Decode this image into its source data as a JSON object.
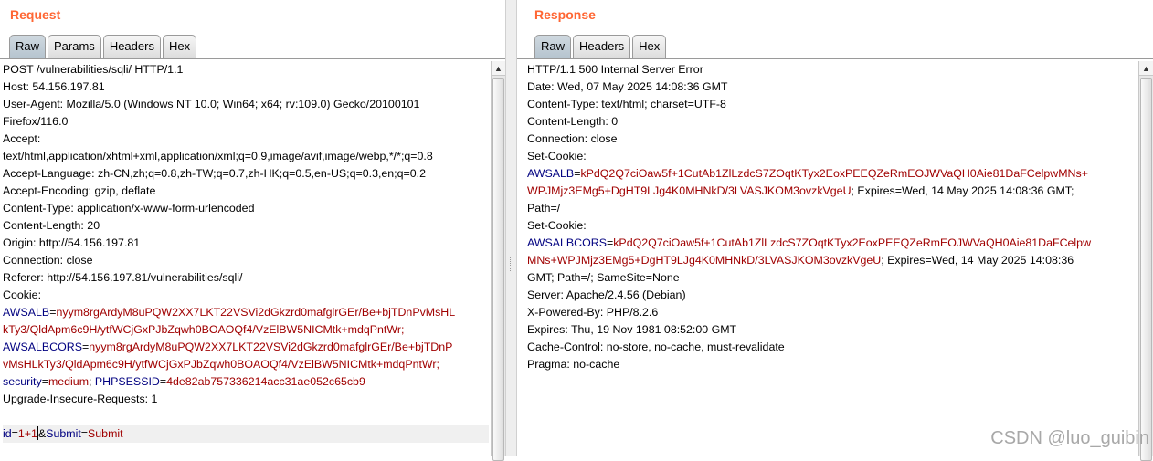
{
  "request": {
    "title": "Request",
    "tabs": [
      "Raw",
      "Params",
      "Headers",
      "Hex"
    ],
    "active_tab": "Raw",
    "lines": [
      "POST /vulnerabilities/sqli/ HTTP/1.1",
      "Host: 54.156.197.81",
      "User-Agent: Mozilla/5.0 (Windows NT 10.0; Win64; x64; rv:109.0) Gecko/20100101",
      "Firefox/116.0",
      "Accept:",
      "text/html,application/xhtml+xml,application/xml;q=0.9,image/avif,image/webp,*/*;q=0.8",
      "Accept-Language: zh-CN,zh;q=0.8,zh-TW;q=0.7,zh-HK;q=0.5,en-US;q=0.3,en;q=0.2",
      "Accept-Encoding: gzip, deflate",
      "Content-Type: application/x-www-form-urlencoded",
      "Content-Length: 20",
      "Origin: http://54.156.197.81",
      "Connection: close",
      "Referer: http://54.156.197.81/vulnerabilities/sqli/",
      "Cookie:"
    ],
    "cookie_lines": [
      {
        "k": "AWSALB",
        "eq": "=",
        "v": "nyym8rgArdyM8uPQW2XX7LKT22VSVi2dGkzrd0mafglrGEr/Be+bjTDnPvMsHL"
      },
      {
        "k": "",
        "eq": "",
        "v": "kTy3/QldApm6c9H/ytfWCjGxPJbZqwh0BOAOQf4/VzElBW5NICMtk+mdqPntWr;"
      },
      {
        "k": "AWSALBCORS",
        "eq": "=",
        "v": "nyym8rgArdyM8uPQW2XX7LKT22VSVi2dGkzrd0mafglrGEr/Be+bjTDnP"
      },
      {
        "k": "",
        "eq": "",
        "v": "vMsHLkTy3/QldApm6c9H/ytfWCjGxPJbZqwh0BOAOQf4/VzElBW5NICMtk+mdqPntWr;"
      }
    ],
    "security_line": {
      "k1": "security",
      "v1": "medium",
      "sep": "; ",
      "k2": "PHPSESSID",
      "v2": "4de82ab757336214acc31ae052c65cb9"
    },
    "upgrade_line": "Upgrade-Insecure-Requests: 1",
    "body_line": {
      "k1": "id",
      "v1a": "1+1",
      "v1b": "",
      "amp": "&",
      "k2": "Submit",
      "v2": "Submit"
    }
  },
  "response": {
    "title": "Response",
    "tabs": [
      "Raw",
      "Headers",
      "Hex"
    ],
    "active_tab": "Raw",
    "lines_top": [
      "HTTP/1.1 500 Internal Server Error",
      "Date: Wed, 07 May 2025 14:08:36 GMT",
      "Content-Type: text/html; charset=UTF-8",
      "Content-Length: 0",
      "Connection: close",
      "Set-Cookie:"
    ],
    "cookie1": {
      "k": "AWSALB",
      "v1": "kPdQ2Q7ciOaw5f+1CutAb1ZlLzdcS7ZOqtKTyx2EoxPEEQZeRmEOJWVaQH0Aie81DaFCelpwMNs+",
      "v2": "WPJMjz3EMg5+DgHT9LJg4K0MHNkD/3LVASJKOM3ovzkVgeU",
      "rest": "; Expires=Wed, 14 May 2025 14:08:36 GMT;",
      "rest2": "Path=/"
    },
    "setcookie2_label": "Set-Cookie:",
    "cookie2": {
      "k": "AWSALBCORS",
      "v1": "kPdQ2Q7ciOaw5f+1CutAb1ZlLzdcS7ZOqtKTyx2EoxPEEQZeRmEOJWVaQH0Aie81DaFCelpw",
      "v2": "MNs+WPJMjz3EMg5+DgHT9LJg4K0MHNkD/3LVASJKOM3ovzkVgeU",
      "rest": "; Expires=Wed, 14 May 2025 14:08:36",
      "rest2": "GMT; Path=/; SameSite=None"
    },
    "lines_bottom": [
      "Server: Apache/2.4.56 (Debian)",
      "X-Powered-By: PHP/8.2.6",
      "Expires: Thu, 19 Nov 1981 08:52:00 GMT",
      "Cache-Control: no-store, no-cache, must-revalidate",
      "Pragma: no-cache"
    ]
  },
  "watermark": "CSDN @luo_guibin",
  "colors": {
    "title": "#ff6633",
    "key": "#000080",
    "value": "#a00000"
  }
}
